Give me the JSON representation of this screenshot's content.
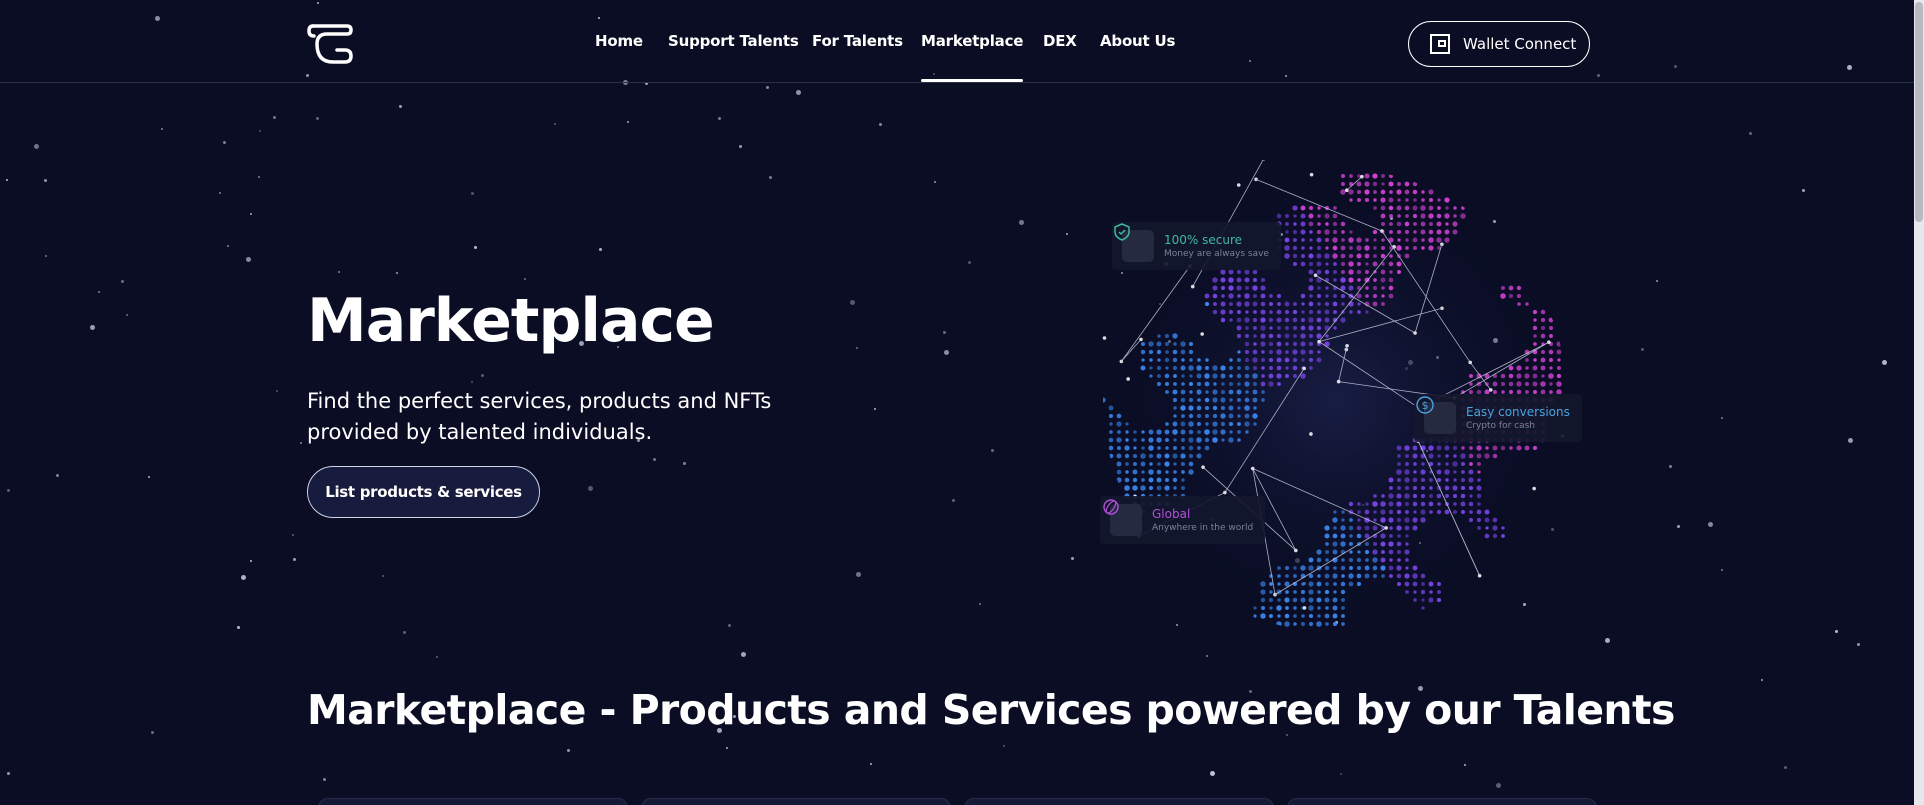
{
  "header": {
    "logo_icon": "talents-logo-icon",
    "nav": [
      {
        "label": "Home",
        "active": false
      },
      {
        "label": "Support Talents",
        "active": false
      },
      {
        "label": "For Talents",
        "active": false
      },
      {
        "label": "Marketplace",
        "active": true
      },
      {
        "label": "DEX",
        "active": false
      },
      {
        "label": "About Us",
        "active": false
      }
    ],
    "wallet_button": {
      "label": "Wallet Connect",
      "icon": "wallet-icon"
    }
  },
  "hero": {
    "title": "Marketplace",
    "subtitle": "Find the perfect services, products and NFTs provided by talented individuals.",
    "cta_label": "List products & services"
  },
  "globe": {
    "badges": [
      {
        "title": "100% secure",
        "desc": "Money are always save",
        "icon": "shield-icon",
        "color": "#3fb8a0"
      },
      {
        "title": "Easy conversions",
        "desc": "Crypto for cash",
        "icon": "dollar-exchange-icon",
        "color": "#4aa3e0"
      },
      {
        "title": "Global",
        "desc": "Anywhere in the world",
        "icon": "globe-spin-icon",
        "color": "#b04fd8"
      }
    ]
  },
  "section": {
    "title": "Marketplace - Products and Services powered by our Talents"
  },
  "colors": {
    "background": "#0a0d24",
    "accent_purple": "#9b3fe0",
    "accent_blue": "#3a6ee8"
  }
}
